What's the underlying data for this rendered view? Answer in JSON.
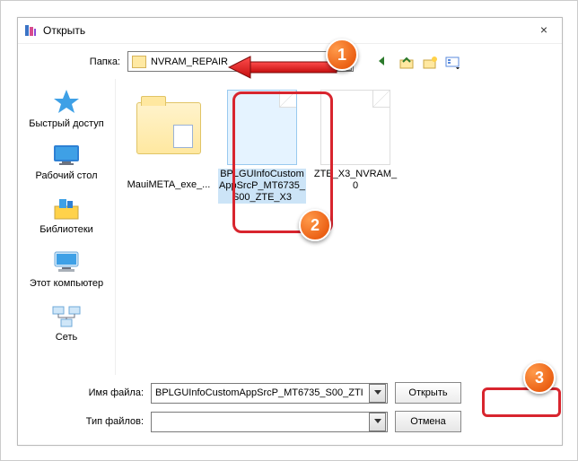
{
  "window": {
    "title": "Открыть",
    "close": "×"
  },
  "folder": {
    "label": "Папка:",
    "value": "NVRAM_REPAIR"
  },
  "sidebar": [
    {
      "id": "quick",
      "label": "Быстрый доступ"
    },
    {
      "id": "desktop",
      "label": "Рабочий стол"
    },
    {
      "id": "libs",
      "label": "Библиотеки"
    },
    {
      "id": "pc",
      "label": "Этот компьютер"
    },
    {
      "id": "net",
      "label": "Сеть"
    }
  ],
  "files": [
    {
      "id": "f0",
      "type": "folder",
      "label": "MauiMETA_exe_...",
      "selected": false
    },
    {
      "id": "f1",
      "type": "file",
      "label": "BPLGUInfoCustomAppSrcP_MT6735_S00_ZTE_X3",
      "selected": true
    },
    {
      "id": "f2",
      "type": "file",
      "label": "ZTE_X3_NVRAM_0",
      "selected": false
    }
  ],
  "fields": {
    "filename_label": "Имя файла:",
    "filename_value": "BPLGUInfoCustomAppSrcP_MT6735_S00_ZTI",
    "filetype_label": "Тип файлов:",
    "filetype_value": ""
  },
  "buttons": {
    "open": "Открыть",
    "cancel": "Отмена"
  },
  "annotations": {
    "b1": "1",
    "b2": "2",
    "b3": "3"
  },
  "colors": {
    "highlight": "#d8252e",
    "badge": "#e34a00"
  }
}
